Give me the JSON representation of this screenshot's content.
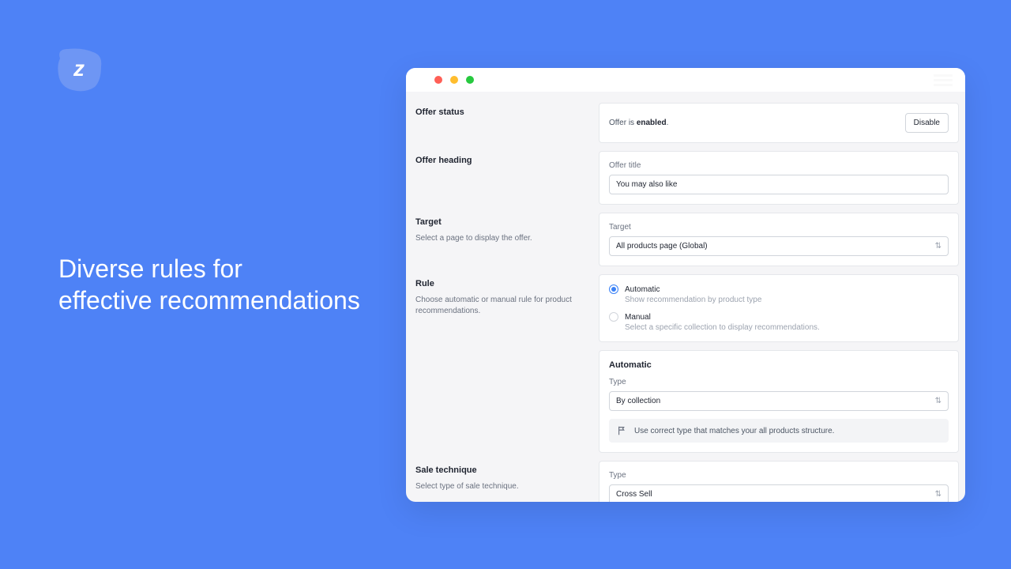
{
  "headline_line1": "Diverse rules for",
  "headline_line2": "effective recommendations",
  "sections": {
    "offer_status": {
      "title": "Offer status"
    },
    "offer_heading": {
      "title": "Offer heading"
    },
    "target": {
      "title": "Target",
      "subtitle": "Select a page to display the offer."
    },
    "rule": {
      "title": "Rule",
      "subtitle": "Choose automatic or manual rule for product recommendations."
    },
    "sale": {
      "title": "Sale technique",
      "subtitle": "Select type of sale technique."
    }
  },
  "status": {
    "prefix": "Offer is ",
    "state": "enabled",
    "suffix": ".",
    "button": "Disable"
  },
  "offer_title": {
    "label": "Offer title",
    "value": "You may also like"
  },
  "target": {
    "label": "Target",
    "value": "All products page (Global)"
  },
  "rule": {
    "automatic": {
      "label": "Automatic",
      "desc": "Show recommendation by product type"
    },
    "manual": {
      "label": "Manual",
      "desc": "Select a specific collection to display recommendations."
    }
  },
  "automatic": {
    "heading": "Automatic",
    "type_label": "Type",
    "type_value": "By collection",
    "hint": "Use correct type that matches your all products structure."
  },
  "sale_type": {
    "label": "Type",
    "value": "Cross Sell"
  }
}
